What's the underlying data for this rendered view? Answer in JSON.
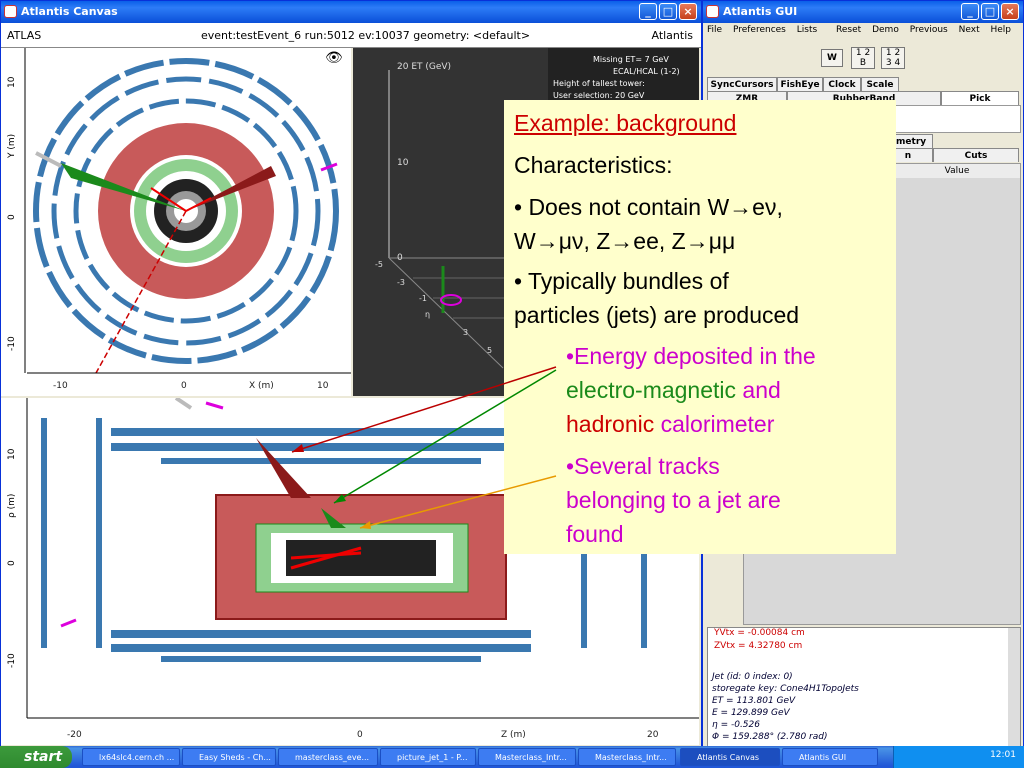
{
  "canvas_window": {
    "title": "Atlantis Canvas",
    "header_left": "ATLAS",
    "header_center": "event:testEvent_6 run:5012 ev:10037  geometry: <default>",
    "header_right": "Atlantis",
    "xy_view": {
      "x_ticks": [
        "-10",
        "0",
        "10"
      ],
      "x_label": "X (m)",
      "y_ticks": [
        "10",
        "0",
        "-10"
      ],
      "y_label": "Y (m)"
    },
    "rz_view": {
      "x_ticks": [
        "-20",
        "0",
        "20"
      ],
      "x_label": "Z (m)",
      "y_ticks": [
        "10",
        "0",
        "-10"
      ],
      "y_label": "ρ (m)"
    },
    "lego_view": {
      "axis_top": "20 ET (GeV)",
      "tick_10": "10",
      "tick_0": "0",
      "legend": [
        "Missing ET= 7 GeV",
        "ECAL/HCAL (1-2)",
        "Height of tallest tower:",
        "User selection: 20 GeV"
      ],
      "eta_label": "η",
      "misc": [
        "-5",
        "-3",
        "-1",
        "1",
        "3",
        "5"
      ]
    }
  },
  "gui_window": {
    "title": "Atlantis GUI",
    "menu": [
      "File",
      "Preferences",
      "Lists"
    ],
    "menu_right": [
      "Reset",
      "Demo",
      "Previous",
      "Next",
      "Help"
    ],
    "w_button": "W",
    "grid_a": [
      "1",
      "2",
      "B"
    ],
    "grid_b": [
      "1",
      "2",
      "3",
      "4"
    ],
    "tabs_row1": [
      "SyncCursors",
      "FishEye",
      "Clock",
      "Scale"
    ],
    "tabs_row2": [
      "ZMR",
      "RubberBand",
      "Pick"
    ],
    "tab_geometry": "ometry",
    "tab_cuts": "Cuts",
    "tab_n": "n",
    "column_value": "Value",
    "output_red": [
      "YVtx = -0.00084 cm",
      "ZVtx = 4.32780 cm"
    ],
    "output_lines": [
      "Jet (id: 0 index: 0)",
      " storegate key: Cone4H1TopoJets",
      " ET  = 113.801 GeV",
      " E   = 129.899 GeV",
      " η = -0.526",
      " Φ = 159.288°  (2.780 rad)"
    ]
  },
  "slide_note": {
    "title": "Example: background",
    "characteristics": "Characteristics:",
    "bullet1_a": "• Does not contain W→eν,",
    "bullet1_b": "W→μν, Z→ee, Z→μμ",
    "bullet2_a": "• Typically bundles of",
    "bullet2_b": "particles (jets) are produced",
    "sub1_a": "•Energy deposited in the",
    "sub1_b_green": "electro-magnetic",
    "sub1_b_and": " and",
    "sub1_c_red": "hadronic",
    "sub1_c_rest": " calorimeter",
    "sub2_a": "•Several tracks",
    "sub2_b": "belonging to a jet are",
    "sub2_c": "found"
  },
  "taskbar": {
    "start": "start",
    "tasks": [
      "lx64slc4.cern.ch ...",
      "Easy Sheds - Ch...",
      "masterclass_eve...",
      "picture_jet_1 - P...",
      "Masterclass_Intr...",
      "Masterclass_Intr...",
      "Atlantis Canvas",
      "Atlantis GUI"
    ],
    "clock": "12:01"
  },
  "colors": {
    "hadronic": "#c85a5a",
    "em": "#8fd08f",
    "muon": "#3a78b0",
    "magenta": "#cc00cc"
  }
}
